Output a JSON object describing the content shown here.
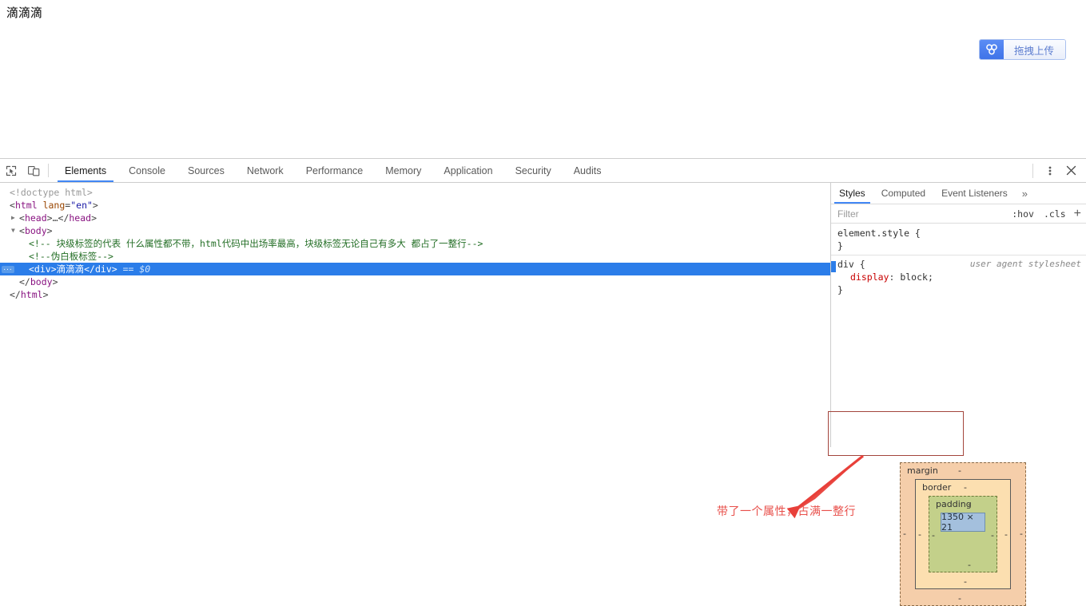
{
  "page": {
    "body_text": "滴滴滴",
    "upload_widget": {
      "icon": "baidu-cloud-icon",
      "label": "拖拽上传"
    }
  },
  "devtools": {
    "toolbar": {
      "inspect_icon": "inspect-element-icon",
      "device_icon": "device-toolbar-icon",
      "tabs": [
        {
          "label": "Elements",
          "active": true
        },
        {
          "label": "Console",
          "active": false
        },
        {
          "label": "Sources",
          "active": false
        },
        {
          "label": "Network",
          "active": false
        },
        {
          "label": "Performance",
          "active": false
        },
        {
          "label": "Memory",
          "active": false
        },
        {
          "label": "Application",
          "active": false
        },
        {
          "label": "Security",
          "active": false
        },
        {
          "label": "Audits",
          "active": false
        }
      ],
      "more_icon": "vertical-dots-icon",
      "close_icon": "close-icon"
    },
    "dom_tree": [
      {
        "id": "doctype",
        "text": "<!doctype html>"
      },
      {
        "id": "html_open",
        "text": "<html lang=\"en\">"
      },
      {
        "id": "head",
        "text": "<head>…</head>"
      },
      {
        "id": "body_open",
        "text": "<body>"
      },
      {
        "id": "comment1",
        "text": "<!-- 块级标签的代表 什么属性都不带，html代码中出场率最高，块级标签无论自己有多大 都占了一整行-->"
      },
      {
        "id": "comment2",
        "text": "<!--伪白板标签-->"
      },
      {
        "id": "div_selected",
        "text": "<div>滴滴滴</div>",
        "suffix": "== $0",
        "selected": true
      },
      {
        "id": "body_close",
        "text": "</body>"
      },
      {
        "id": "html_close",
        "text": "</html>"
      }
    ],
    "dom_parts": {
      "doctype": "<!doctype html>",
      "html_tag": "html",
      "html_attr_name": "lang",
      "html_attr_value": "\"en\"",
      "head_tag": "head",
      "head_collapsed": "…",
      "body_tag": "body",
      "comment1": "<!-- 块级标签的代表 什么属性都不带，html代码中出场率最高，块级标签无论自己有多大 都占了一整行-->",
      "comment2": "<!--伪白板标签-->",
      "div_open": "<div>",
      "div_text": "滴滴滴",
      "div_close": "</div>",
      "div_marker": "== $0",
      "ellipsis_badge": "...",
      "body_close": "</body>",
      "html_close": "</html>",
      "twisty_collapsed": "▶",
      "twisty_expanded": "▼"
    },
    "annotation": {
      "text": "带了一个属性，占满一整行",
      "color": "#e8504b",
      "arrow": "red-arrow-pointing-down-left",
      "highlight_box_color": "#a3453c"
    },
    "styles": {
      "tabs": [
        {
          "label": "Styles",
          "active": true
        },
        {
          "label": "Computed",
          "active": false
        },
        {
          "label": "Event Listeners",
          "active": false
        }
      ],
      "more_tabs_icon": "»",
      "filter": {
        "placeholder": "Filter",
        "value": ""
      },
      "hov_label": ":hov",
      "cls_label": ".cls",
      "new_rule_label": "+",
      "rules": [
        {
          "selector": "element.style {",
          "close": "}",
          "declarations": [],
          "origin": ""
        },
        {
          "selector": "div {",
          "close": "}",
          "declarations": [
            {
              "name": "display",
              "value": "block;"
            }
          ],
          "origin": "user agent stylesheet"
        }
      ]
    },
    "box_model": {
      "margin_label": "margin",
      "border_label": "border",
      "padding_label": "padding",
      "content_size": "1350 × 21",
      "dash": "-",
      "colors": {
        "margin": "#f5ceaa",
        "border": "#fcdfb0",
        "padding": "#c3d08a",
        "content": "#a4c0dd"
      }
    }
  }
}
